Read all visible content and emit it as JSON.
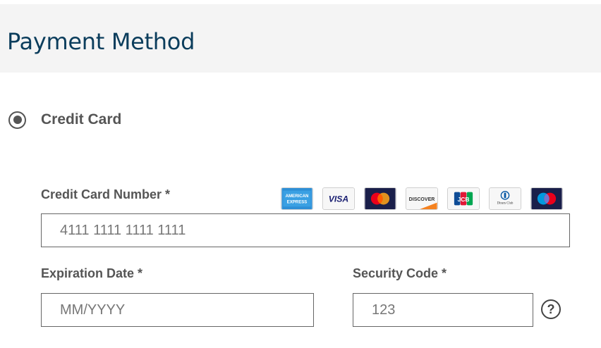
{
  "header": {
    "title": "Payment Method"
  },
  "payment_option": {
    "label": "Credit Card",
    "selected": true
  },
  "card_number": {
    "label": "Credit Card Number *",
    "placeholder": "4111 1111 1111 1111"
  },
  "expiration": {
    "label": "Expiration Date *",
    "placeholder": "MM/YYYY"
  },
  "security": {
    "label": "Security Code *",
    "placeholder": "123"
  },
  "card_brands": [
    {
      "name": "amex-icon",
      "text_line1": "AMERICAN",
      "text_line2": "EXPRESS",
      "color": "#2e8fd6"
    },
    {
      "name": "visa-icon",
      "text": "VISA",
      "color": "#1a1f71"
    },
    {
      "name": "mastercard-icon",
      "color": "#1a1f4a"
    },
    {
      "name": "discover-icon",
      "text": "DISCOVER",
      "color": "#f58220"
    },
    {
      "name": "jcb-icon",
      "text": "JCB",
      "color": "#0e4c96"
    },
    {
      "name": "diners-club-icon",
      "text": "Diners Club",
      "color": "#0a5aa5"
    },
    {
      "name": "maestro-icon",
      "color": "#1a1f4a"
    }
  ],
  "help_icon": {
    "symbol": "?"
  }
}
